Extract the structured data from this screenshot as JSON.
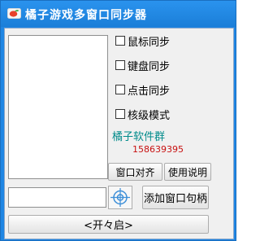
{
  "window": {
    "title": "橘子游戏多窗口同步器"
  },
  "options": [
    {
      "label": "鼠标同步",
      "checked": false
    },
    {
      "label": "键盘同步",
      "checked": false
    },
    {
      "label": "点击同步",
      "checked": false
    },
    {
      "label": "核级模式",
      "checked": false
    }
  ],
  "group": {
    "name": "橘子软件群",
    "number": "158639395"
  },
  "buttons": {
    "align": "窗口对齐",
    "help": "使用说明",
    "add_handle": "添加窗口句柄",
    "start": "<开々启>"
  },
  "handle_input": {
    "value": ""
  },
  "icons": {
    "app": "orange-fruit-icon",
    "picker": "crosshair-target-icon"
  },
  "colors": {
    "titlebar": "#1f86e4",
    "group_name": "#008b8b",
    "group_number": "#c81010"
  }
}
